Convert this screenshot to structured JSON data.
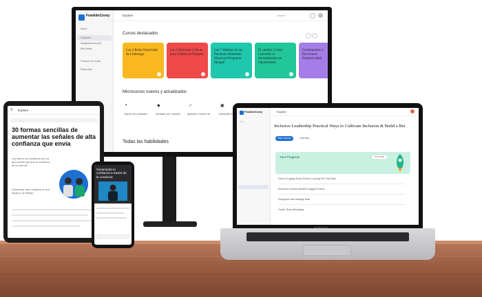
{
  "monitor": {
    "brand": "FranklinCovey",
    "nav": [
      "Inicio",
      "Explorar",
      "Asignaciones (0)",
      "Mis listas",
      "Cursos en curso",
      "Recursos"
    ],
    "topbar_title": "Explore",
    "search_placeholder": "Search",
    "section1": "Cursos destacados",
    "cards": [
      {
        "title": "Los 4 Roles Esenciales de Liderazgo",
        "color": "#f9b820"
      },
      {
        "title": "Las 6 Prácticas Críticas para Líderes en Equipos",
        "color": "#f0494a"
      },
      {
        "title": "Los 7 Hábitos de las Personas Altamente Efectivas Programa Integral",
        "color": "#1fc7ad"
      },
      {
        "title": "El cambio: Cómo Convertir la Incertidumbre en Oportunidad",
        "color": "#21c79a"
      },
      {
        "title": "Fundamentos 5 Elecciones Productividad",
        "color": "#a57de8"
      }
    ],
    "section2": "Microcursos nuevos y actualizados",
    "micro": [
      {
        "label": "Operar con confianza",
        "icon": "◐"
      },
      {
        "label": "Mensajes de 2 minutos",
        "icon": "◆"
      },
      {
        "label": "Aprender a través de",
        "icon": "✓"
      },
      {
        "label": "Sobresale en el trabajo",
        "icon": "▣"
      }
    ],
    "section3": "Todas las habilidades"
  },
  "tablet": {
    "topbar": "Explore",
    "heading": "30 formas sencillas de aumentar las señales de alta confianza que envía",
    "para1": "Los líderes de confianza son los que pueden generar la confianza de los demás.",
    "para2": "Desarrollar alta confianza en sus equipos de trabajo."
  },
  "phone": {
    "title": "Generando la confianza a través de la conducta"
  },
  "laptop": {
    "brand": "FranklinCovey",
    "topbar": "Explore",
    "title": "Inclusive Leadership Practical Ways to Cultivate Inclusion & Build a Better Team",
    "banner": "Your Progress",
    "banner_badge": "5% DONE",
    "button1": "Start Journey",
    "button2": "Overview",
    "rows": [
      "How to Engage Every Person Looking Out This Start",
      "Embrace Inclusion Builds Engaged Teams",
      "Recognize and Manage Bias",
      "Foster Team Belonging"
    ],
    "model": "MacBook Pro"
  }
}
